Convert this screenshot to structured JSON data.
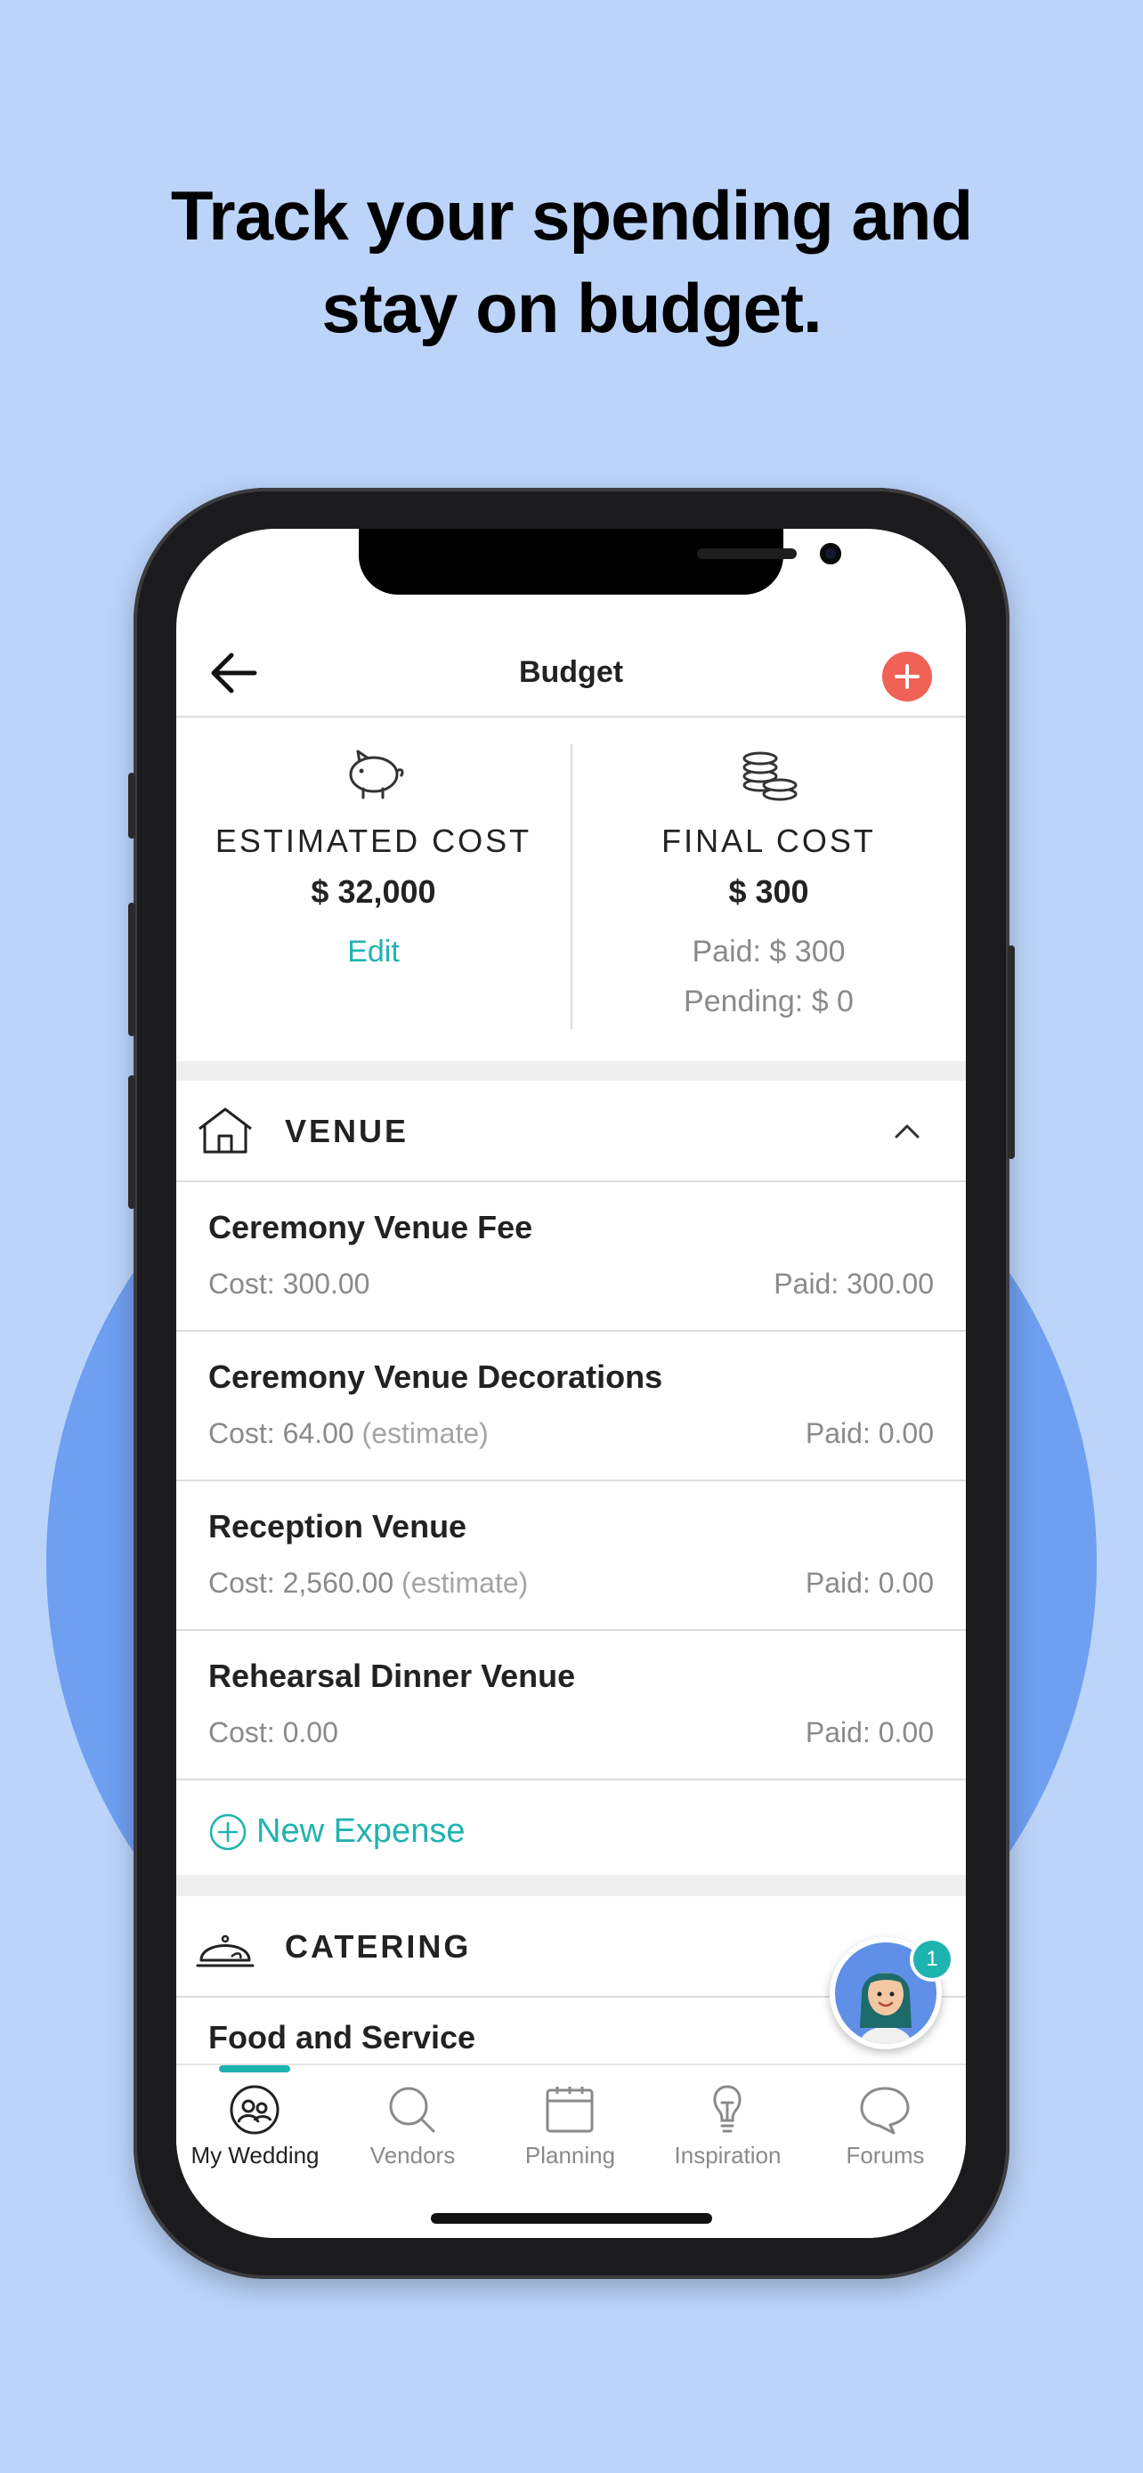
{
  "headline": {
    "line1": "Track your spending and",
    "line2": "stay on budget."
  },
  "nav": {
    "title": "Budget",
    "back_icon": "arrow-left-icon",
    "add_icon": "plus-circle-icon",
    "add_color": "#ef6255"
  },
  "summary": {
    "estimated": {
      "icon": "piggy-bank-icon",
      "label": "ESTIMATED COST",
      "value": "$ 32,000",
      "edit_label": "Edit"
    },
    "final": {
      "icon": "coins-icon",
      "label": "FINAL COST",
      "value": "$ 300",
      "paid": "Paid: $ 300",
      "pending": "Pending: $ 0"
    }
  },
  "categories": [
    {
      "icon": "house-icon",
      "title": "VENUE",
      "expanded": true,
      "items": [
        {
          "name": "Ceremony Venue Fee",
          "cost": "Cost: 300.00",
          "estimate": "",
          "paid": "Paid: 300.00"
        },
        {
          "name": "Ceremony Venue Decorations",
          "cost": "Cost: 64.00",
          "estimate": "(estimate)",
          "paid": "Paid: 0.00"
        },
        {
          "name": "Reception Venue",
          "cost": "Cost: 2,560.00",
          "estimate": "(estimate)",
          "paid": "Paid: 0.00"
        },
        {
          "name": "Rehearsal Dinner Venue",
          "cost": "Cost: 0.00",
          "estimate": "",
          "paid": "Paid: 0.00"
        }
      ],
      "new_expense_label": "New Expense"
    },
    {
      "icon": "cloche-icon",
      "title": "CATERING",
      "items": [
        {
          "name": "Food and Service"
        }
      ]
    }
  ],
  "chat": {
    "icon": "assistant-avatar-icon",
    "badge": "1"
  },
  "tabs": [
    {
      "label": "My Wedding",
      "icon": "couple-icon",
      "active": true
    },
    {
      "label": "Vendors",
      "icon": "search-icon",
      "active": false
    },
    {
      "label": "Planning",
      "icon": "notepad-icon",
      "active": false
    },
    {
      "label": "Inspiration",
      "icon": "lightbulb-icon",
      "active": false
    },
    {
      "label": "Forums",
      "icon": "chat-bubble-icon",
      "active": false
    }
  ],
  "colors": {
    "accent": "#1fb3b0",
    "background": "#bcd4fa",
    "circle": "#6f9ff0"
  }
}
